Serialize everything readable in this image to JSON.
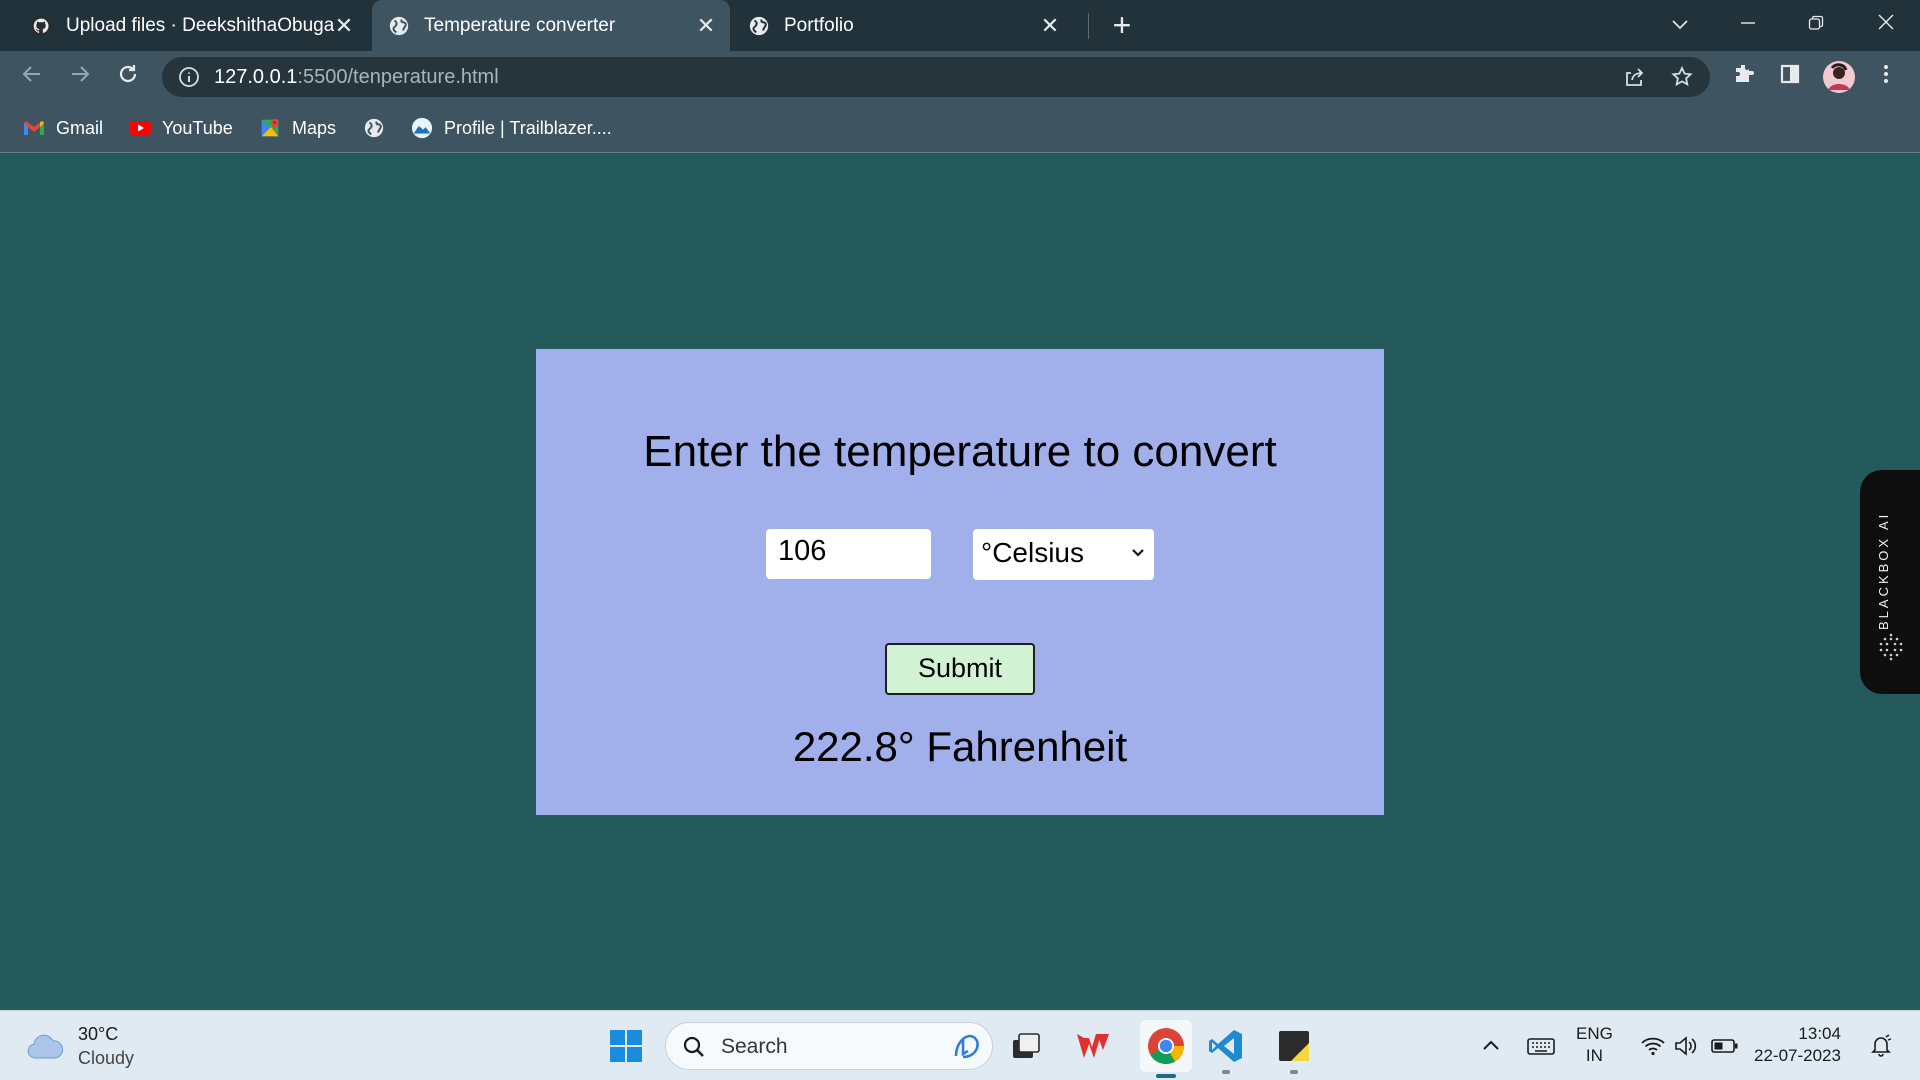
{
  "browser": {
    "tabs": [
      {
        "title": "Upload files · DeekshithaObugari",
        "active": false,
        "icon": "github-icon"
      },
      {
        "title": "Temperature converter",
        "active": true,
        "icon": "globe-icon"
      },
      {
        "title": "Portfolio",
        "active": false,
        "icon": "globe-icon"
      }
    ],
    "address": {
      "host": "127.0.0.1",
      "rest": ":5500/tenperature.html"
    },
    "bookmarks": [
      {
        "label": "Gmail",
        "icon": "gmail-icon"
      },
      {
        "label": "YouTube",
        "icon": "youtube-icon"
      },
      {
        "label": "Maps",
        "icon": "maps-icon"
      },
      {
        "label": "",
        "icon": "globe-icon"
      },
      {
        "label": "Profile | Trailblazer....",
        "icon": "trailblazer-icon"
      }
    ]
  },
  "page": {
    "heading": "Enter the temperature to convert",
    "input_value": "106",
    "unit_selected": "°Celsius",
    "submit_label": "Submit",
    "result": "222.8° Fahrenheit"
  },
  "blackbox": {
    "label": "BLACKBOX AI"
  },
  "taskbar": {
    "weather_temp": "30°C",
    "weather_condition": "Cloudy",
    "search_placeholder": "Search",
    "lang_line1": "ENG",
    "lang_line2": "IN",
    "time": "13:04",
    "date": "22-07-2023"
  },
  "colors": {
    "page_bg": "#255a5c",
    "card_bg": "#a1b0eb",
    "submit_bg": "#d2f2d4",
    "chrome_dark": "#21323b",
    "chrome_active": "#3e5561"
  }
}
